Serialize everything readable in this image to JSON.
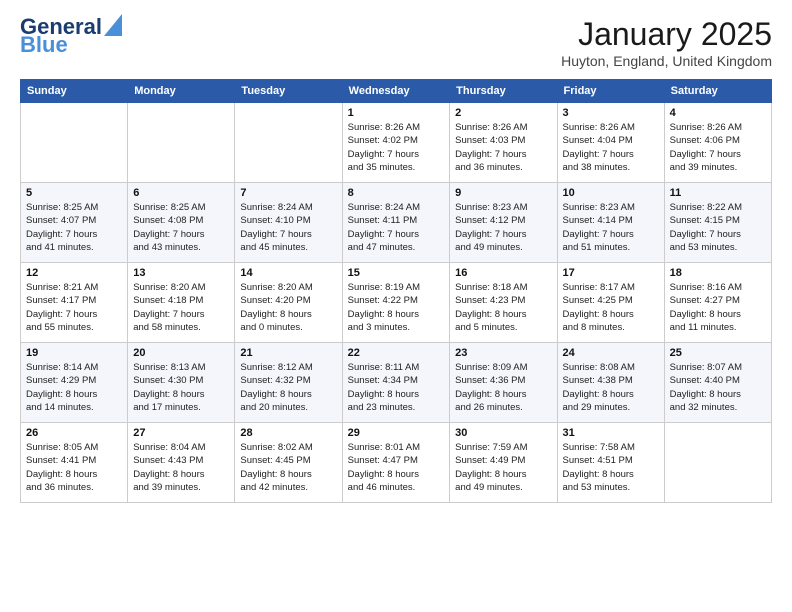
{
  "header": {
    "logo_general": "General",
    "logo_blue": "Blue",
    "title": "January 2025",
    "location": "Huyton, England, United Kingdom"
  },
  "weekdays": [
    "Sunday",
    "Monday",
    "Tuesday",
    "Wednesday",
    "Thursday",
    "Friday",
    "Saturday"
  ],
  "weeks": [
    [
      {
        "day": "",
        "info": ""
      },
      {
        "day": "",
        "info": ""
      },
      {
        "day": "",
        "info": ""
      },
      {
        "day": "1",
        "info": "Sunrise: 8:26 AM\nSunset: 4:02 PM\nDaylight: 7 hours\nand 35 minutes."
      },
      {
        "day": "2",
        "info": "Sunrise: 8:26 AM\nSunset: 4:03 PM\nDaylight: 7 hours\nand 36 minutes."
      },
      {
        "day": "3",
        "info": "Sunrise: 8:26 AM\nSunset: 4:04 PM\nDaylight: 7 hours\nand 38 minutes."
      },
      {
        "day": "4",
        "info": "Sunrise: 8:26 AM\nSunset: 4:06 PM\nDaylight: 7 hours\nand 39 minutes."
      }
    ],
    [
      {
        "day": "5",
        "info": "Sunrise: 8:25 AM\nSunset: 4:07 PM\nDaylight: 7 hours\nand 41 minutes."
      },
      {
        "day": "6",
        "info": "Sunrise: 8:25 AM\nSunset: 4:08 PM\nDaylight: 7 hours\nand 43 minutes."
      },
      {
        "day": "7",
        "info": "Sunrise: 8:24 AM\nSunset: 4:10 PM\nDaylight: 7 hours\nand 45 minutes."
      },
      {
        "day": "8",
        "info": "Sunrise: 8:24 AM\nSunset: 4:11 PM\nDaylight: 7 hours\nand 47 minutes."
      },
      {
        "day": "9",
        "info": "Sunrise: 8:23 AM\nSunset: 4:12 PM\nDaylight: 7 hours\nand 49 minutes."
      },
      {
        "day": "10",
        "info": "Sunrise: 8:23 AM\nSunset: 4:14 PM\nDaylight: 7 hours\nand 51 minutes."
      },
      {
        "day": "11",
        "info": "Sunrise: 8:22 AM\nSunset: 4:15 PM\nDaylight: 7 hours\nand 53 minutes."
      }
    ],
    [
      {
        "day": "12",
        "info": "Sunrise: 8:21 AM\nSunset: 4:17 PM\nDaylight: 7 hours\nand 55 minutes."
      },
      {
        "day": "13",
        "info": "Sunrise: 8:20 AM\nSunset: 4:18 PM\nDaylight: 7 hours\nand 58 minutes."
      },
      {
        "day": "14",
        "info": "Sunrise: 8:20 AM\nSunset: 4:20 PM\nDaylight: 8 hours\nand 0 minutes."
      },
      {
        "day": "15",
        "info": "Sunrise: 8:19 AM\nSunset: 4:22 PM\nDaylight: 8 hours\nand 3 minutes."
      },
      {
        "day": "16",
        "info": "Sunrise: 8:18 AM\nSunset: 4:23 PM\nDaylight: 8 hours\nand 5 minutes."
      },
      {
        "day": "17",
        "info": "Sunrise: 8:17 AM\nSunset: 4:25 PM\nDaylight: 8 hours\nand 8 minutes."
      },
      {
        "day": "18",
        "info": "Sunrise: 8:16 AM\nSunset: 4:27 PM\nDaylight: 8 hours\nand 11 minutes."
      }
    ],
    [
      {
        "day": "19",
        "info": "Sunrise: 8:14 AM\nSunset: 4:29 PM\nDaylight: 8 hours\nand 14 minutes."
      },
      {
        "day": "20",
        "info": "Sunrise: 8:13 AM\nSunset: 4:30 PM\nDaylight: 8 hours\nand 17 minutes."
      },
      {
        "day": "21",
        "info": "Sunrise: 8:12 AM\nSunset: 4:32 PM\nDaylight: 8 hours\nand 20 minutes."
      },
      {
        "day": "22",
        "info": "Sunrise: 8:11 AM\nSunset: 4:34 PM\nDaylight: 8 hours\nand 23 minutes."
      },
      {
        "day": "23",
        "info": "Sunrise: 8:09 AM\nSunset: 4:36 PM\nDaylight: 8 hours\nand 26 minutes."
      },
      {
        "day": "24",
        "info": "Sunrise: 8:08 AM\nSunset: 4:38 PM\nDaylight: 8 hours\nand 29 minutes."
      },
      {
        "day": "25",
        "info": "Sunrise: 8:07 AM\nSunset: 4:40 PM\nDaylight: 8 hours\nand 32 minutes."
      }
    ],
    [
      {
        "day": "26",
        "info": "Sunrise: 8:05 AM\nSunset: 4:41 PM\nDaylight: 8 hours\nand 36 minutes."
      },
      {
        "day": "27",
        "info": "Sunrise: 8:04 AM\nSunset: 4:43 PM\nDaylight: 8 hours\nand 39 minutes."
      },
      {
        "day": "28",
        "info": "Sunrise: 8:02 AM\nSunset: 4:45 PM\nDaylight: 8 hours\nand 42 minutes."
      },
      {
        "day": "29",
        "info": "Sunrise: 8:01 AM\nSunset: 4:47 PM\nDaylight: 8 hours\nand 46 minutes."
      },
      {
        "day": "30",
        "info": "Sunrise: 7:59 AM\nSunset: 4:49 PM\nDaylight: 8 hours\nand 49 minutes."
      },
      {
        "day": "31",
        "info": "Sunrise: 7:58 AM\nSunset: 4:51 PM\nDaylight: 8 hours\nand 53 minutes."
      },
      {
        "day": "",
        "info": ""
      }
    ]
  ]
}
